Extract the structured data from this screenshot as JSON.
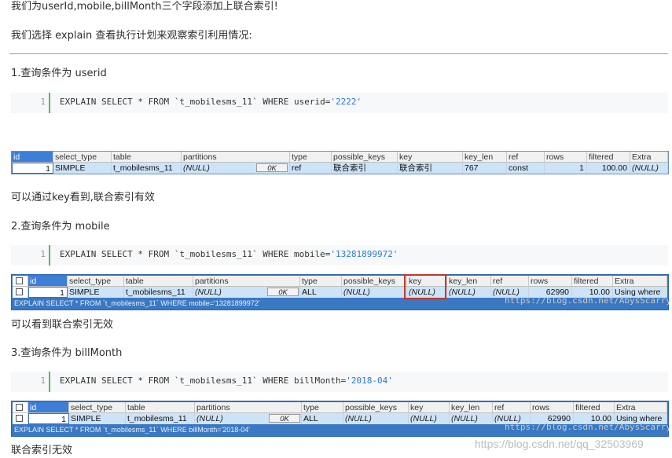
{
  "intro": {
    "line1": "我们为userId,mobile,billMonth三个字段添加上联合索引!",
    "line2": "我们选择 explain 查看执行计划来观察索引利用情况:"
  },
  "columns": [
    "id",
    "select_type",
    "table",
    "partitions",
    "type",
    "possible_keys",
    "key",
    "key_len",
    "ref",
    "rows",
    "filtered",
    "Extra"
  ],
  "ok_label": "0K",
  "sections": [
    {
      "heading": "1.查询条件为 userid",
      "code": {
        "line_no": "1",
        "prefix": "EXPLAIN SELECT * FROM `t_mobilesms_11` WHERE userid=",
        "literal": "'2222'"
      },
      "row": [
        "1",
        "SIMPLE",
        "t_mobilesms_11",
        "(NULL)",
        "ref",
        "联合索引",
        "联合索引",
        "767",
        "const",
        "1",
        "100.00",
        "(NULL)"
      ],
      "footer": "可以通过key看到,联合索引有效"
    },
    {
      "heading": "2.查询条件为 mobile",
      "code": {
        "line_no": "1",
        "prefix": "EXPLAIN SELECT * FROM `t_mobilesms_11` WHERE mobile=",
        "literal": "'13281899972'"
      },
      "row": [
        "1",
        "SIMPLE",
        "t_mobilesms_11",
        "(NULL)",
        "ALL",
        "(NULL)",
        "(NULL)",
        "(NULL)",
        "(NULL)",
        "62990",
        "10.00",
        "Using where"
      ],
      "status": "EXPLAIN SELECT * FROM `t_mobilesms_11` WHERE mobile='13281899972'",
      "footer": "可以看到联合索引无效"
    },
    {
      "heading": "3.查询条件为 billMonth",
      "code": {
        "line_no": "1",
        "prefix": "EXPLAIN SELECT * FROM `t_mobilesms_11` WHERE billMonth=",
        "literal": "'2018-04'"
      },
      "row": [
        "1",
        "SIMPLE",
        "t_mobilesms_11",
        "(NULL)",
        "ALL",
        "(NULL)",
        "(NULL)",
        "(NULL)",
        "(NULL)",
        "62990",
        "10.00",
        "Using where"
      ],
      "status": "EXPLAIN SELECT * FROM `t_mobilesms_11` WHERE billMonth='2018-04'",
      "footer": "联合索引无效"
    }
  ],
  "watermarks": {
    "inner": "https://blog.csdn.net/AbysScarry",
    "outer": "https://blog.csdn.net/qq_32503969"
  }
}
